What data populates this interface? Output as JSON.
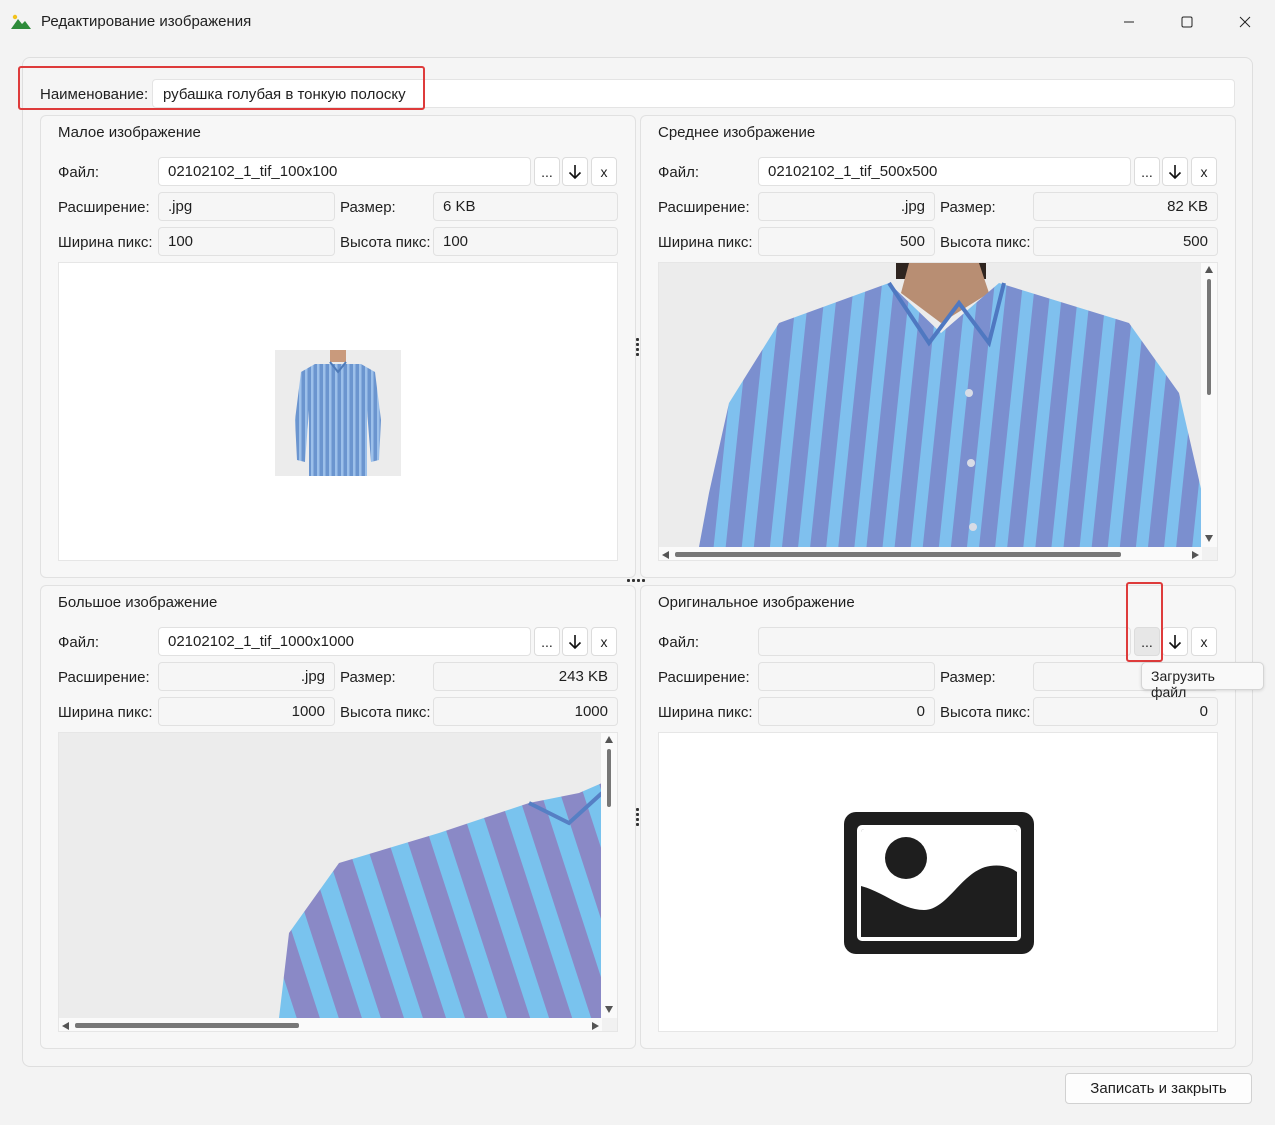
{
  "window": {
    "title": "Редактирование изображения",
    "icon": "landscape-image-icon"
  },
  "name_field": {
    "label": "Наименование:",
    "value": "рубашка голубая в тонкую полоску"
  },
  "labels": {
    "file": "Файл:",
    "extension": "Расширение:",
    "size": "Размер:",
    "width": "Ширина пикс:",
    "height": "Высота пикс:",
    "browse": "...",
    "download": "↓",
    "clear": "x"
  },
  "groups": {
    "small": {
      "title": "Малое изображение",
      "file": "02102102_1_tif_100x100",
      "extension": ".jpg",
      "size": "6 KB",
      "width": "100",
      "height": "100"
    },
    "medium": {
      "title": "Среднее изображение",
      "file": "02102102_1_tif_500x500",
      "extension": ".jpg",
      "size": "82 KB",
      "width": "500",
      "height": "500"
    },
    "large": {
      "title": "Большое изображение",
      "file": "02102102_1_tif_1000x1000",
      "extension": ".jpg",
      "size": "243 KB",
      "width": "1000",
      "height": "1000"
    },
    "original": {
      "title": "Оригинальное изображение",
      "file": "",
      "extension": "",
      "size": "",
      "width": "0",
      "height": "0",
      "placeholder_icon": "image-placeholder-icon"
    }
  },
  "tooltip": "Загрузить файл",
  "footer": {
    "save_close": "Записать и закрыть"
  },
  "colors": {
    "highlight": "#de3b3b",
    "shirt_blue": "#6f9fd6",
    "shirt_stripe": "#8fb6e6"
  }
}
